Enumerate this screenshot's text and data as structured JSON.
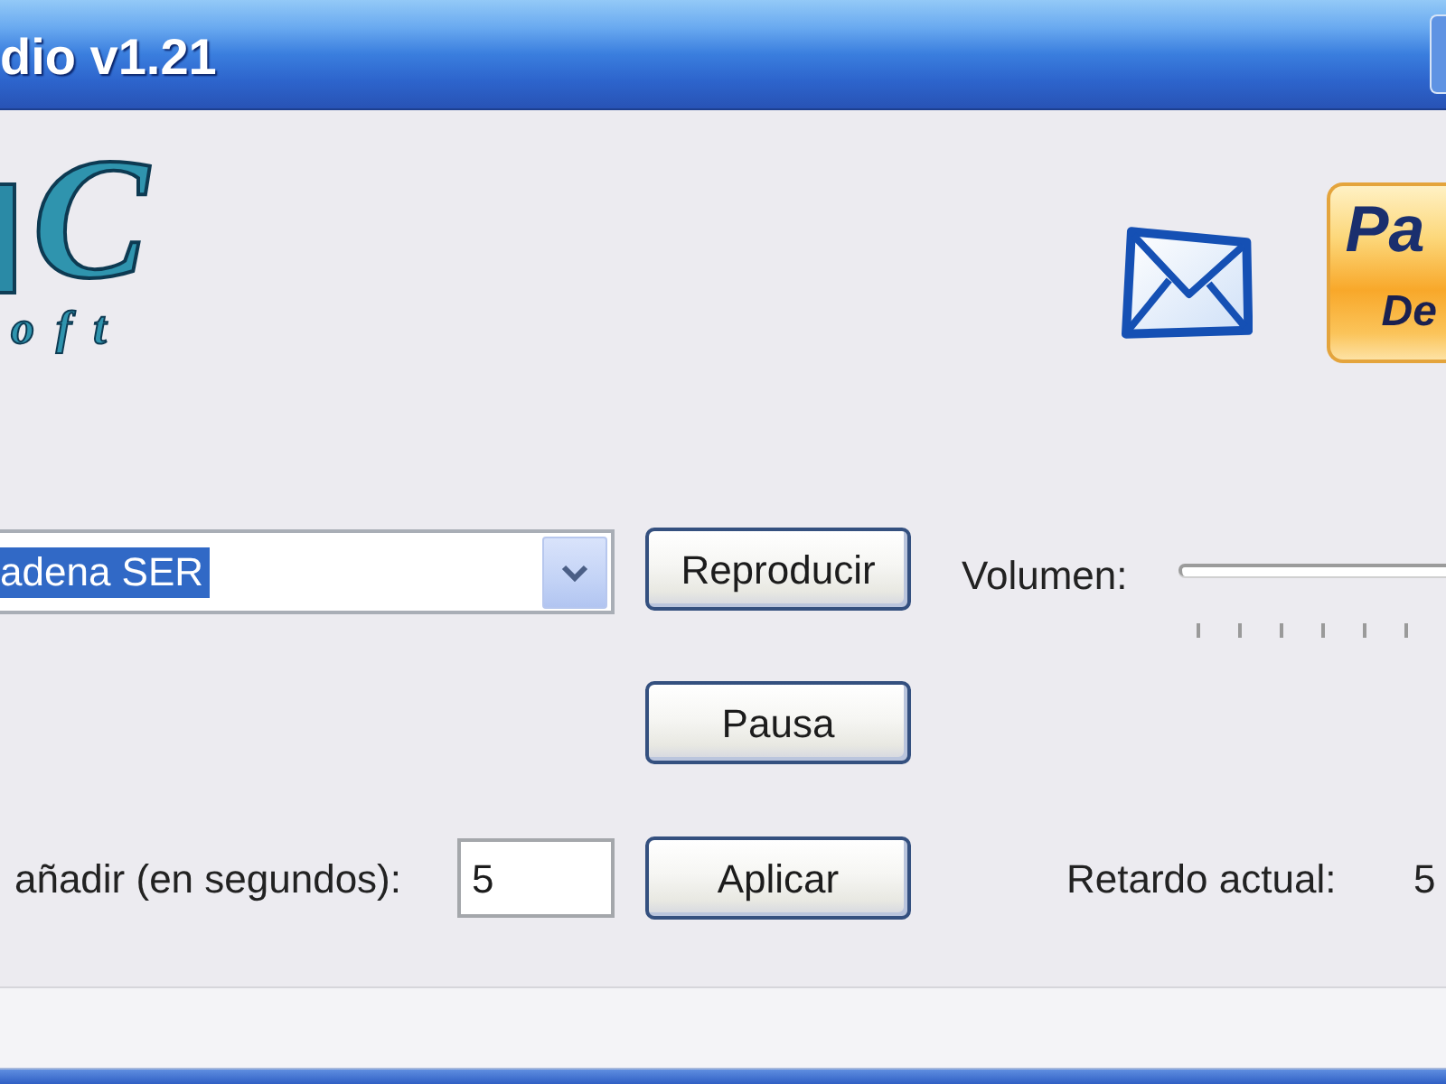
{
  "window": {
    "title": "dio v1.21"
  },
  "header": {
    "logo": {
      "text": "C",
      "subtitle": "oft"
    },
    "donate_button": {
      "line_1": "Pa",
      "line_2": "De"
    }
  },
  "playback": {
    "station": {
      "value": "adena SER",
      "highlighted": true
    },
    "play_button": "Reproducir",
    "pause_button": "Pausa",
    "volume": {
      "label": "Volumen:"
    }
  },
  "delay": {
    "label": "añadir (en segundos):",
    "input": {
      "value": "5"
    },
    "apply_button": "Aplicar",
    "current_label": "Retardo actual:",
    "current_value": "5"
  }
}
